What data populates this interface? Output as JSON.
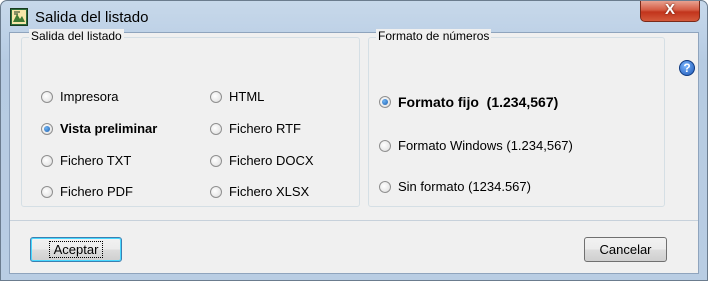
{
  "window": {
    "title": "Salida del listado",
    "close_label": "X"
  },
  "output_group": {
    "label": "Salida del listado",
    "options": [
      {
        "label": "Impresora",
        "checked": false
      },
      {
        "label": "Vista preliminar",
        "checked": true
      },
      {
        "label": "Fichero TXT",
        "checked": false
      },
      {
        "label": "Fichero PDF",
        "checked": false
      },
      {
        "label": "HTML",
        "checked": false
      },
      {
        "label": "Fichero RTF",
        "checked": false
      },
      {
        "label": "Fichero DOCX",
        "checked": false
      },
      {
        "label": "Fichero XLSX",
        "checked": false
      }
    ]
  },
  "number_format_group": {
    "label": "Formato de números",
    "options": [
      {
        "label": "Formato fijo  (1.234,567)",
        "checked": true
      },
      {
        "label": "Formato Windows (1.234,567)",
        "checked": false
      },
      {
        "label": "Sin formato (1234.567)",
        "checked": false
      }
    ]
  },
  "help_icon": "?",
  "buttons": {
    "accept": "Aceptar",
    "cancel": "Cancelar"
  },
  "colors": {
    "accent": "#3c7fb1",
    "close": "#c2341c"
  }
}
